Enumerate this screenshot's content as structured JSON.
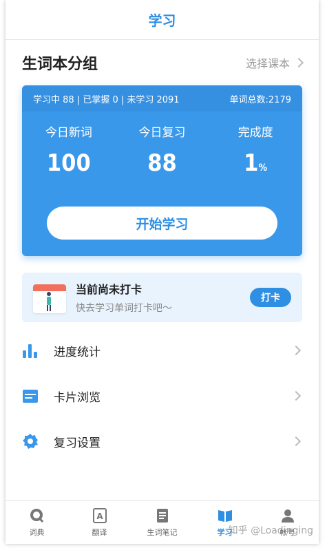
{
  "nav": {
    "title": "学习"
  },
  "section": {
    "title": "生词本分组",
    "select_label": "选择课本"
  },
  "card": {
    "status_left": "学习中 88 | 已掌握 0 | 未学习 2091",
    "status_right": "单词总数:2179",
    "stats": [
      {
        "label": "今日新词",
        "value": "100",
        "unit": ""
      },
      {
        "label": "今日复习",
        "value": "88",
        "unit": ""
      },
      {
        "label": "完成度",
        "value": "1",
        "unit": "%"
      }
    ],
    "start_label": "开始学习"
  },
  "checkin": {
    "title": "当前尚未打卡",
    "subtitle": "快去学习单词打卡吧～",
    "button_label": "打卡"
  },
  "menu": [
    {
      "label": "进度统计",
      "icon": "bar-chart-icon"
    },
    {
      "label": "卡片浏览",
      "icon": "cards-icon"
    },
    {
      "label": "复习设置",
      "icon": "gear-icon"
    }
  ],
  "tabs": [
    {
      "label": "词典",
      "icon": "dictionary-icon",
      "active": false
    },
    {
      "label": "翻译",
      "icon": "translate-icon",
      "active": false
    },
    {
      "label": "生词笔记",
      "icon": "notes-icon",
      "active": false
    },
    {
      "label": "学习",
      "icon": "study-icon",
      "active": true
    },
    {
      "label": "帐号",
      "icon": "account-icon",
      "active": false
    }
  ],
  "watermark": "知乎 @Loadinging",
  "colors": {
    "accent": "#2f8fe3",
    "card": "#3a98ea",
    "checkin_bg": "#e9f3fd"
  }
}
